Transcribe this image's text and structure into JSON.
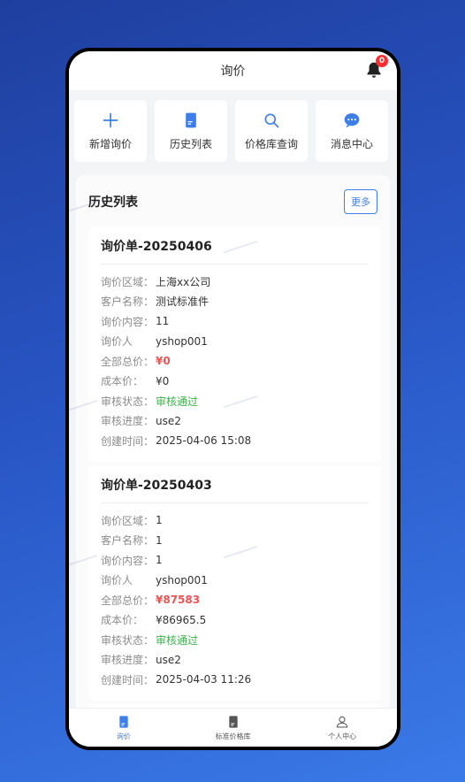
{
  "header": {
    "title": "询价",
    "notification_count": "0"
  },
  "quick_actions": [
    {
      "label": "新增询价",
      "icon": "plus-icon"
    },
    {
      "label": "历史列表",
      "icon": "document-icon"
    },
    {
      "label": "价格库查询",
      "icon": "search-icon"
    },
    {
      "label": "消息中心",
      "icon": "chat-bubble-icon"
    }
  ],
  "history": {
    "title": "历史列表",
    "more_label": "更多",
    "field_labels": {
      "region": "询价区域：",
      "customer": "客户名称：",
      "content": "询价内容：",
      "requester": "询价人",
      "total": "全部总价：",
      "cost": "成本价：",
      "status": "审核状态：",
      "progress": "审核进度：",
      "created": "创建时间："
    },
    "orders": [
      {
        "title": "询价单-20250406",
        "region": "上海xx公司",
        "customer": "测试标准件",
        "content": "11",
        "requester": "yshop001",
        "total": "¥0",
        "cost": "¥0",
        "status": "审核通过",
        "progress": "use2",
        "created": "2025-04-06 15:08"
      },
      {
        "title": "询价单-20250403",
        "region": "1",
        "customer": "1",
        "content": "1",
        "requester": "yshop001",
        "total": "¥87583",
        "cost": "¥86965.5",
        "status": "审核通过",
        "progress": "use2",
        "created": "2025-04-03 11:26"
      }
    ]
  },
  "tabbar": [
    {
      "label": "询价",
      "icon": "inquiry-doc-icon",
      "active": true
    },
    {
      "label": "标准价格库",
      "icon": "price-library-icon",
      "active": false
    },
    {
      "label": "个人中心",
      "icon": "user-icon",
      "active": false
    }
  ],
  "colors": {
    "accent": "#3d7fe6",
    "price_red": "#f05252",
    "status_green": "#3bb54a"
  }
}
